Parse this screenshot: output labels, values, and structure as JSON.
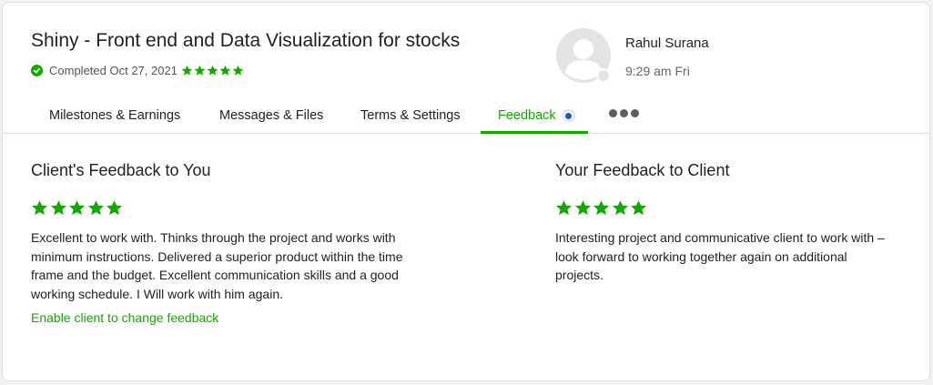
{
  "project": {
    "title": "Shiny - Front end and Data Visualization for stocks",
    "status": "Completed Oct 27, 2021",
    "rating": 5
  },
  "client": {
    "name": "Rahul Surana",
    "local_time": "9:29 am Fri"
  },
  "tabs": [
    {
      "label": "Milestones & Earnings"
    },
    {
      "label": "Messages & Files"
    },
    {
      "label": "Terms & Settings"
    },
    {
      "label": "Feedback",
      "active": true
    }
  ],
  "client_feedback": {
    "heading": "Client's Feedback to You",
    "rating": 5,
    "lines": [
      "Excellent to work with. Thinks through the project and works with",
      "minimum instructions. Delivered a superior product within the time",
      "frame and the budget. Excellent communication skills and a good",
      "working schedule. I Will work with him again."
    ],
    "link": "Enable client to change feedback"
  },
  "your_feedback": {
    "heading": "Your Feedback to Client",
    "rating": 5,
    "lines": [
      "Interesting project and communicative client to work with –",
      "look forward to working together again on additional",
      "projects."
    ]
  },
  "colors": {
    "accent": "#14a800",
    "indicator": "#1f57c3",
    "border": "#e0e0e0"
  },
  "icons": {
    "status": "check-circle-icon",
    "rating": "star-icon",
    "avatar": "user-avatar-icon",
    "more": "more-horizontal-icon"
  }
}
